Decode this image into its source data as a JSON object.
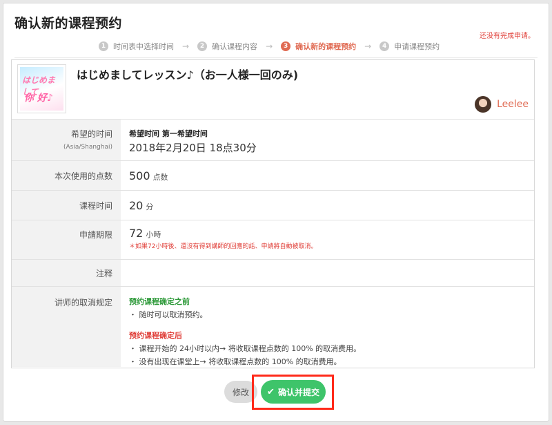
{
  "page": {
    "title": "确认新的课程预约",
    "status": "还没有完成申请。"
  },
  "steps": [
    {
      "num": "1",
      "label": "时间表中选择时间"
    },
    {
      "num": "2",
      "label": "确认课程内容"
    },
    {
      "num": "3",
      "label": "确认新的课程预约"
    },
    {
      "num": "4",
      "label": "申请课程预约"
    }
  ],
  "lesson": {
    "thumb_line1": "はじめまして",
    "thumb_line2": "你 好♪",
    "title": "はじめましてレッスン♪（お一人様一回のみ)",
    "teacher": "Leelee"
  },
  "details": {
    "time_label": "希望的时间",
    "time_zone": "(Asia/Shanghai)",
    "time_caption": "希望时间 第一希望时间",
    "time_value": "2018年2月20日 18点30分",
    "points_label": "本次使用的点数",
    "points_value": "500",
    "points_unit": "点数",
    "duration_label": "课程时间",
    "duration_value": "20",
    "duration_unit": "分",
    "deadline_label": "申請期限",
    "deadline_value": "72",
    "deadline_unit": "小時",
    "deadline_note": "＊如果72小時後、還沒有得到講師的回應的話、申請將自動被取消。",
    "notes_label": "注释",
    "policy_label": "讲师的取消规定",
    "policy_before_title": "预约课程确定之前",
    "policy_before_1": "・ 随时可以取消预约。",
    "policy_after_title": "预约课程确定后",
    "policy_after_1": "・ 课程开始的 24小时以内→ 将收取课程点数的 100% 的取消费用。",
    "policy_after_2": "・ 没有出现在课堂上→ 将收取课程点数的 100% 的取消费用。"
  },
  "buttons": {
    "edit": "修改",
    "confirm": "确认并提交"
  },
  "icons": {
    "check": "check-icon",
    "avatar": "avatar"
  },
  "colors": {
    "accent": "#e06a52",
    "confirm": "#3ec46a",
    "highlight": "#ff2a1a",
    "warning": "#e0403a",
    "green_text": "#2e9a3a"
  }
}
